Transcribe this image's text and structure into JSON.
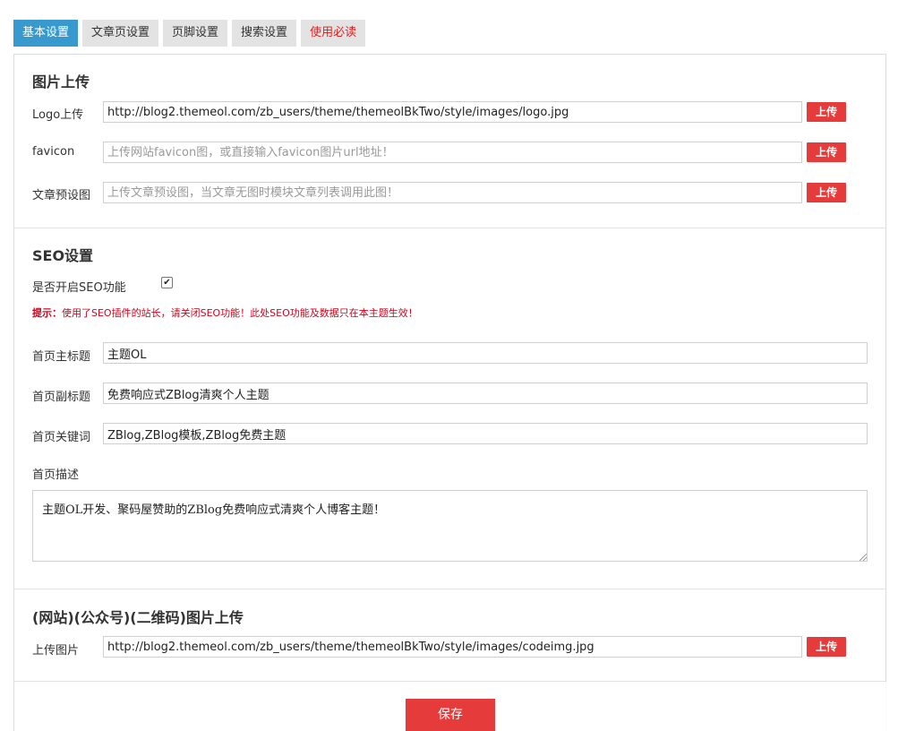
{
  "tabs": [
    {
      "label": "基本设置"
    },
    {
      "label": "文章页设置"
    },
    {
      "label": "页脚设置"
    },
    {
      "label": "搜索设置"
    },
    {
      "label": "使用必读"
    }
  ],
  "image_upload": {
    "heading": "图片上传",
    "logo": {
      "label": "Logo上传",
      "value": "http://blog2.themeol.com/zb_users/theme/themeolBkTwo/style/images/logo.jpg",
      "placeholder": ""
    },
    "favicon": {
      "label": "favicon",
      "value": "",
      "placeholder": "上传网站favicon图，或直接输入favicon图片url地址！"
    },
    "preview": {
      "label": "文章预设图",
      "value": "",
      "placeholder": "上传文章预设图，当文章无图时模块文章列表调用此图！"
    },
    "upload_label": "上传"
  },
  "seo": {
    "heading": "SEO设置",
    "enable_label": "是否开启SEO功能",
    "enable_checked": true,
    "hint_prefix": "提示：",
    "hint_text": "使用了SEO插件的站长，请关闭SEO功能！此处SEO功能及数据只在本主题生效！",
    "title": {
      "label": "首页主标题",
      "value": "主题OL"
    },
    "subtitle": {
      "label": "首页副标题",
      "value": "免费响应式ZBlog清爽个人主题"
    },
    "keywords": {
      "label": "首页关键词",
      "value": "ZBlog,ZBlog模板,ZBlog免费主题"
    },
    "description": {
      "label": "首页描述",
      "value": "主题OL开发、聚码屋赞助的ZBlog免费响应式清爽个人博客主题！"
    }
  },
  "qrcode": {
    "heading": "(网站)(公众号)(二维码)图片上传",
    "label": "上传图片",
    "value": "http://blog2.themeol.com/zb_users/theme/themeolBkTwo/style/images/codeimg.jpg",
    "upload_label": "上传"
  },
  "save_label": "保存"
}
